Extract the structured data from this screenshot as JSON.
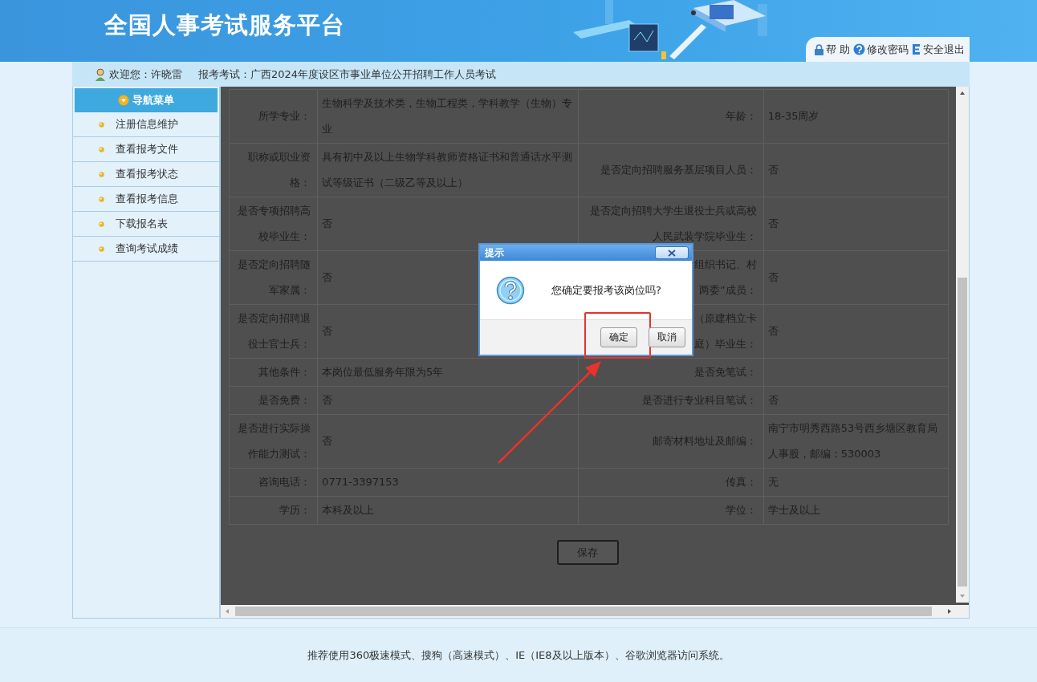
{
  "header": {
    "title": "全国人事考试服务平台",
    "links": [
      {
        "kind": "lock",
        "label": "帮 助"
      },
      {
        "kind": "help",
        "label": "修改密码"
      },
      {
        "kind": "exit",
        "label": "安全退出"
      }
    ]
  },
  "info_bar": {
    "welcome": "欢迎您：许晓雷",
    "exam": "报考考试：广西2024年度设区市事业单位公开招聘工作人员考试"
  },
  "sidebar": {
    "title": "导航菜单",
    "items": [
      "注册信息维护",
      "查看报考文件",
      "查看报考状态",
      "查看报考信息",
      "下载报名表",
      "查询考试成绩"
    ]
  },
  "table": {
    "rows": [
      [
        "所学专业：",
        "生物科学及技术类，生物工程类，学科教学（生物）专业",
        "年龄：",
        "18-35周岁"
      ],
      [
        "职称或职业资格：",
        "具有初中及以上生物学科教师资格证书和普通话水平测试等级证书（二级乙等及以上）",
        "是否定向招聘服务基层项目人员：",
        "否"
      ],
      [
        "是否专项招聘高校毕业生：",
        "否",
        "是否定向招聘大学生退役士兵或高校人民武装学院毕业生：",
        "否"
      ],
      [
        "是否定向招聘随军家属：",
        "否",
        [
          "组织书记、村",
          "两委”成员："
        ],
        "否"
      ],
      [
        "是否定向招聘退役士官士兵：",
        "否",
        [
          "（原建档立卡",
          "庭）毕业生："
        ],
        "否"
      ],
      [
        "其他条件：",
        "本岗位最低服务年限为5年",
        "是否免笔试：",
        ""
      ],
      [
        "是否免费：",
        "否",
        "是否进行专业科目笔试：",
        "否"
      ],
      [
        "是否进行实际操作能力测试：",
        "否",
        "邮寄材料地址及邮编：",
        "南宁市明秀西路53号西乡塘区教育局人事股，邮编：530003"
      ],
      [
        "咨询电话：",
        "0771-3397153",
        "传真：",
        "无"
      ],
      [
        "学历：",
        "本科及以上",
        "学位：",
        "学士及以上"
      ]
    ]
  },
  "save_button": "保存",
  "dialog": {
    "title": "提示",
    "message": "您确定要报考该岗位吗?",
    "buttons": [
      {
        "label": "确定",
        "highlighted": true
      },
      {
        "label": "取消",
        "highlighted": false
      }
    ]
  },
  "footer": "推荐使用360极速模式、搜狗（高速模式）、IE（IE8及以上版本）、谷歌浏览器访问系统。"
}
